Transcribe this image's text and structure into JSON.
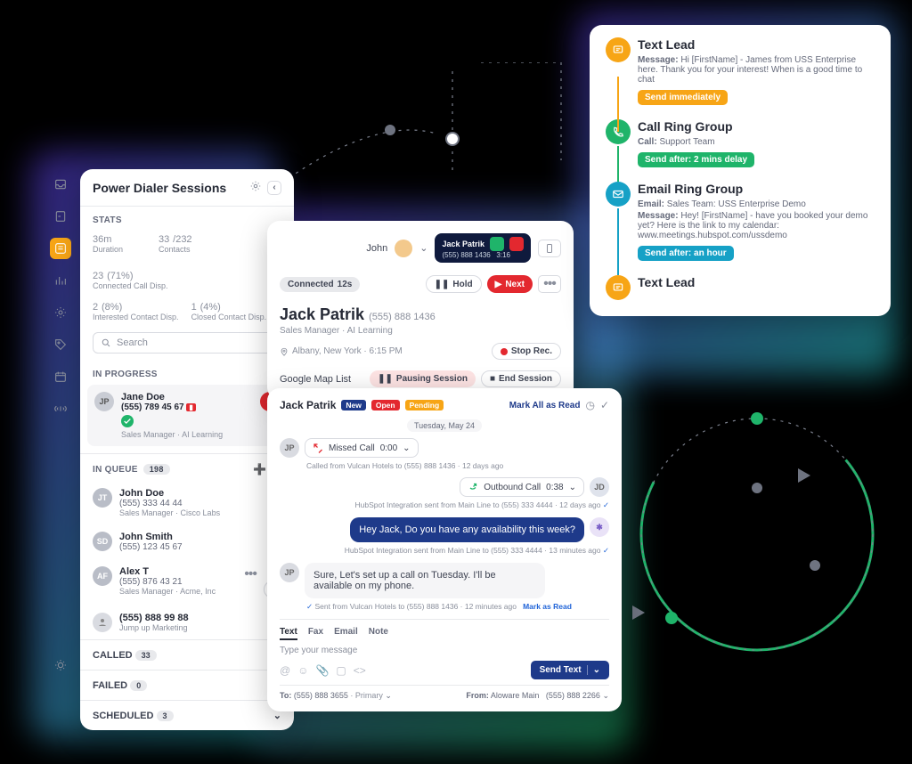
{
  "dialer": {
    "title": "Power Dialer Sessions",
    "stats_label": "STATS",
    "stats": [
      {
        "value": "36m",
        "sub": "",
        "label": "Duration"
      },
      {
        "value": "33",
        "sub": "/232",
        "label": "Contacts"
      },
      {
        "value": "23",
        "sub": "(71%)",
        "label": "Connected Call Disp."
      },
      {
        "value": "2",
        "sub": "(8%)",
        "label": "Interested Contact Disp."
      },
      {
        "value": "1",
        "sub": "(4%)",
        "label": "Closed Contact Disp."
      }
    ],
    "search_placeholder": "Search",
    "in_progress_label": "IN PROGRESS",
    "active": {
      "initials": "JP",
      "name": "Jane Doe",
      "phone": "(555) 789 45 67",
      "role": "Sales Manager",
      "company": "AI Learning"
    },
    "queue_label": "IN QUEUE",
    "queue_count": "198",
    "queue": [
      {
        "initials": "JT",
        "name": "John Doe",
        "phone": "(555) 333 44 44",
        "role": "Sales Manager",
        "company": "Cisco Labs"
      },
      {
        "initials": "SD",
        "name": "John Smith",
        "phone": "(555) 123 45 67",
        "role": "",
        "company": ""
      },
      {
        "initials": "AF",
        "name": "Alex T",
        "phone": "(555) 876 43 21",
        "role": "Sales Manager",
        "company": "Acme, Inc"
      },
      {
        "initials": "",
        "name": "(555) 888 99 88",
        "phone": "Jump up Marketing",
        "role": "",
        "company": ""
      }
    ],
    "accordions": [
      {
        "label": "CALLED",
        "count": "33"
      },
      {
        "label": "FAILED",
        "count": "0"
      },
      {
        "label": "SCHEDULED",
        "count": "3"
      }
    ]
  },
  "call": {
    "user": "John",
    "keypad_name": "Jack Patrik",
    "keypad_phone": "(555) 888 1436",
    "keypad_time": "3:16",
    "status": "Connected",
    "status_time": "12s",
    "hold": "Hold",
    "next": "Next",
    "name": "Jack Patrik",
    "phone": "(555) 888 1436",
    "role": "Sales Manager",
    "company": "AI Learning",
    "location": "Albany, New York · 6:15 PM",
    "stop_rec": "Stop Rec.",
    "map": "Google Map List",
    "pause": "Pausing Session",
    "end": "End Session"
  },
  "chat": {
    "name": "Jack Patrik",
    "tags": [
      {
        "t": "New",
        "bg": "#1e3a8a",
        "c": "#fff"
      },
      {
        "t": "Open",
        "bg": "#e3282f",
        "c": "#fff"
      },
      {
        "t": "Pending",
        "bg": "#f7a516",
        "c": "#fff"
      }
    ],
    "mark_all": "Mark All as Read",
    "date": "Tuesday, May 24",
    "missed": {
      "label": "Missed Call",
      "dur": "0:00"
    },
    "missed_meta": "Called from Vulcan Hotels to  (555) 888 1436  ·  12 days ago",
    "outbound": {
      "label": "Outbound Call",
      "dur": "0:38"
    },
    "outbound_meta": "HubSpot Integration sent from Main Line to  (555) 333 4444  ·  12 days ago",
    "msg_out": "Hey Jack, Do you have any availability this week?",
    "msg_out_meta": "HubSpot Integration sent from Main Line to  (555) 333 4444  ·  13 minutes ago",
    "msg_in": "Sure, Let's set up a call on Tuesday.  I'll be available on my phone.",
    "msg_in_meta_prefix": "Sent from Vulcan Hotels to  (555) 888 1436  ·  12 minutes ago",
    "mark_read": "Mark as Read",
    "composer": {
      "tabs": [
        "Text",
        "Fax",
        "Email",
        "Note"
      ],
      "placeholder": "Type your message",
      "send": "Send Text",
      "to_label": "To:",
      "to": "(555) 888 3655",
      "to_sub": "· Primary",
      "from_label": "From:",
      "from": "Aloware Main",
      "from_num": "(555) 888 2266"
    }
  },
  "seq": [
    {
      "icon": "sms",
      "color": "#f7a516",
      "title": "Text Lead",
      "lines": [
        "Message: Hi [FirstName] - James from USS Enterprise here. Thank you for your interest! When is a good time to chat"
      ],
      "pill": "Send immediately",
      "pill_bg": "#f7a516"
    },
    {
      "icon": "phone",
      "color": "#1fb46a",
      "title": "Call Ring Group",
      "lines": [
        "Call: Support Team"
      ],
      "pill": "Send after: 2 mins delay",
      "pill_bg": "#1fb46a"
    },
    {
      "icon": "mail",
      "color": "#16a1c6",
      "title": "Email Ring Group",
      "lines": [
        "Email: Sales Team: USS Enterprise Demo",
        "Message: Hey! [FirstName] - have you booked your demo yet? Here is the link to my calendar: www.meetings.hubspot.com/ussdemo"
      ],
      "pill": "Send after: an hour",
      "pill_bg": "#16a1c6"
    },
    {
      "icon": "sms",
      "color": "#f7a516",
      "title": "Text Lead",
      "lines": [],
      "pill": "",
      "pill_bg": ""
    }
  ]
}
